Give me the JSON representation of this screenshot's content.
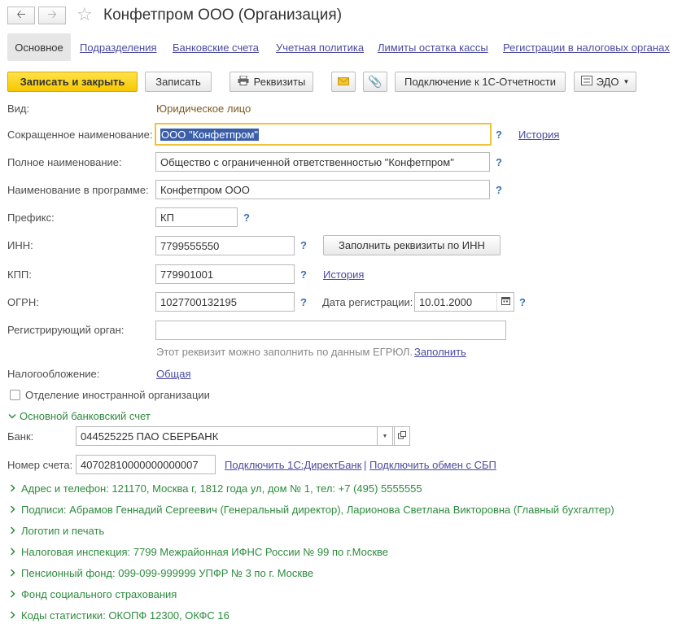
{
  "window": {
    "title": "Конфетпром ООО (Организация)"
  },
  "tabs": [
    {
      "label": "Основное"
    },
    {
      "label": "Подразделения"
    },
    {
      "label": "Банковские счета"
    },
    {
      "label": "Учетная политика"
    },
    {
      "label": "Лимиты остатка кассы"
    },
    {
      "label": "Регистрации в налоговых органах"
    }
  ],
  "toolbar": {
    "save_close": "Записать и закрыть",
    "save": "Записать",
    "requisites": "Реквизиты",
    "connect_1c": "Подключение к 1С-Отчетности",
    "edo": "ЭДО"
  },
  "form": {
    "vid_label": "Вид:",
    "vid_value": "Юридическое лицо",
    "short_name_label": "Сокращенное наименование:",
    "short_name_value": "ООО \"Конфетпром\"",
    "history": "История",
    "full_name_label": "Полное наименование:",
    "full_name_value": "Общество с ограниченной ответственностью \"Конфетпром\"",
    "program_name_label": "Наименование в программе:",
    "program_name_value": "Конфетпром ООО",
    "prefix_label": "Префикс:",
    "prefix_value": "КП",
    "inn_label": "ИНН:",
    "inn_value": "7799555550",
    "fill_by_inn": "Заполнить реквизиты по ИНН",
    "kpp_label": "КПП:",
    "kpp_value": "779901001",
    "ogrn_label": "ОГРН:",
    "ogrn_value": "1027700132195",
    "reg_date_label": "Дата регистрации:",
    "reg_date_value": "10.01.2000",
    "reg_organ_label": "Регистрирующий орган:",
    "reg_organ_value": "",
    "egrul_hint": "Этот реквизит можно заполнить по данным ЕГРЮЛ.",
    "egrul_fill": "Заполнить",
    "taxation_label": "Налогообложение:",
    "taxation_value": "Общая",
    "foreign_branch": "Отделение иностранной организации",
    "question": "?"
  },
  "bank_section": {
    "title": "Основной банковский счет",
    "bank_label": "Банк:",
    "bank_value": "044525225 ПАО СБЕРБАНК",
    "account_label": "Номер счета:",
    "account_value": "40702810000000000007",
    "direct_bank": "Подключить 1С:ДиректБанк",
    "separator": "|",
    "sbp": "Подключить обмен с СБП"
  },
  "groups": [
    {
      "label": "Адрес и телефон: 121170, Москва г, 1812 года ул, дом № 1, тел: +7 (495) 5555555"
    },
    {
      "label": "Подписи: Абрамов Геннадий Сергеевич (Генеральный директор), Ларионова Светлана Викторовна (Главный бухгалтер)"
    },
    {
      "label": "Логотип и печать"
    },
    {
      "label": "Налоговая инспекция: 7799 Межрайонная ИФНС России № 99 по г.Москве"
    },
    {
      "label": "Пенсионный фонд: 099-099-999999 УПФР № 3 по г. Москве"
    },
    {
      "label": "Фонд социального страхования"
    },
    {
      "label": "Коды статистики: ОКОПФ 12300, ОКФС 16"
    }
  ]
}
